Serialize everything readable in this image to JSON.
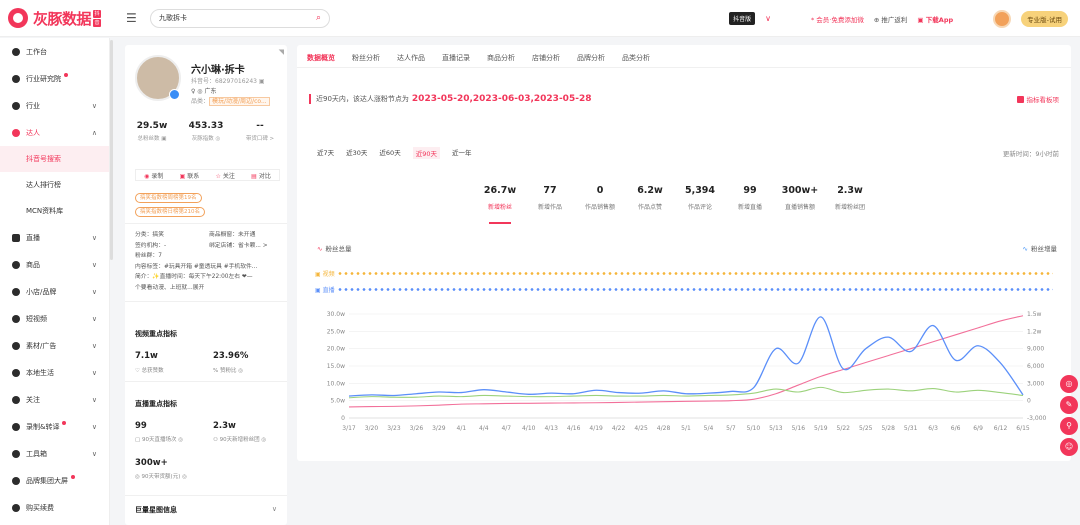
{
  "app": {
    "logo_text": "灰豚数据",
    "logo_badge": [
      "抖",
      "音"
    ]
  },
  "search": {
    "value": "九歌拆卡"
  },
  "topbar": {
    "lang": "抖音版",
    "promo1": "* 会员·免费添加微",
    "promo2": "⊕ 推广返利",
    "app_link": "▣ 下载App",
    "pro_btn": "专业版-试用"
  },
  "sidebar": [
    {
      "label": "工作台",
      "icon": "circle",
      "chevron": false,
      "dot": false
    },
    {
      "label": "行业研究院",
      "icon": "circle",
      "chevron": false,
      "dot": true
    },
    {
      "label": "行业",
      "icon": "circle",
      "chevron": true,
      "dot": false
    },
    {
      "label": "达人",
      "icon": "circle",
      "chevron": true,
      "dot": false,
      "active": true,
      "children": [
        {
          "label": "抖音号搜索",
          "active": true
        },
        {
          "label": "达人排行榜"
        },
        {
          "label": "MCN资料库"
        }
      ]
    },
    {
      "label": "直播",
      "icon": "square",
      "chevron": true,
      "dot": false
    },
    {
      "label": "商品",
      "icon": "circle",
      "chevron": true,
      "dot": false
    },
    {
      "label": "小店/品牌",
      "icon": "circle",
      "chevron": true,
      "dot": false
    },
    {
      "label": "短视频",
      "icon": "circle",
      "chevron": true,
      "dot": false
    },
    {
      "label": "素材/广告",
      "icon": "circle",
      "chevron": true,
      "dot": false
    },
    {
      "label": "本地生活",
      "icon": "circle",
      "chevron": true,
      "dot": false
    },
    {
      "label": "关注",
      "icon": "circle",
      "chevron": true,
      "dot": false
    },
    {
      "label": "录制&转译",
      "icon": "circle",
      "chevron": true,
      "dot": true
    },
    {
      "label": "工具箱",
      "icon": "circle",
      "chevron": true,
      "dot": false
    },
    {
      "label": "品牌集团大屏",
      "icon": "circle",
      "chevron": false,
      "dot": true
    },
    {
      "label": "购买续费",
      "icon": "circle",
      "chevron": false,
      "dot": false
    }
  ],
  "profile": {
    "name": "六小琳·拆卡",
    "id": "抖音号：68297016243 ▣",
    "location": "♀ ◎ 广东",
    "category_label": "品类：",
    "category_value": "模玩/动漫/周边/co...",
    "stats": [
      {
        "value": "29.5w",
        "label": "总粉丝数 ▣"
      },
      {
        "value": "453.33",
        "label": "灰豚指数 ◎"
      },
      {
        "value": "--",
        "label": "带货口碑 >"
      }
    ],
    "actions": [
      {
        "icon": "◉",
        "label": "录制"
      },
      {
        "icon": "▣",
        "label": "联系"
      },
      {
        "icon": "☆",
        "label": "关注"
      },
      {
        "icon": "▤",
        "label": "对比"
      }
    ],
    "rank_tags": [
      "搞笑指数榜周榜第19名",
      "搞笑指数榜日榜第210名"
    ],
    "info": [
      [
        "分类：搞笑",
        "商品橱窗：未开通"
      ],
      [
        "签约机构：-",
        "绑定店铺：省卡颗... >"
      ],
      [
        "粉丝群：7",
        ""
      ],
      [
        "内容标签：#玩具开箱 #童透玩具 #手机软件...",
        ""
      ],
      [
        "简介：✨直播时间：每天下午22:00左右 ❤—",
        ""
      ],
      [
        "个要看动漫、上班就...展开",
        ""
      ]
    ],
    "video_section": {
      "title": "视频重点指标",
      "kpis": [
        {
          "value": "7.1w",
          "label": "♡ 总获赞数"
        },
        {
          "value": "23.96%",
          "label": "% 赞粉比 ◎"
        }
      ]
    },
    "live_section": {
      "title": "直播重点指标",
      "kpis": [
        {
          "value": "99",
          "label": "▢ 90天直播场次 ◎"
        },
        {
          "value": "2.3w",
          "label": "⚇ 90天新增粉丝团 ◎"
        },
        {
          "value": "300w+",
          "label": "◎ 90天带货额(元) ◎"
        }
      ]
    },
    "bottom_title": "巨量星图信息",
    "bottom_chev": "∨"
  },
  "main": {
    "tabs": [
      "数据概览",
      "粉丝分析",
      "达人作品",
      "直播记录",
      "商品分析",
      "店铺分析",
      "品牌分析",
      "品类分析"
    ],
    "period_note": "近90天内，该达人涨粉节点为",
    "period_dates": "2023-05-20,2023-06-03,2023-05-28",
    "metric_btn": "指标看板项",
    "ranges": [
      "近7天",
      "近30天",
      "近60天",
      "近90天",
      "近一年"
    ],
    "range_active": 3,
    "updated": "更新时间：9小时前",
    "metrics": [
      {
        "value": "26.7w",
        "label": "新增粉丝"
      },
      {
        "value": "77",
        "label": "新增作品"
      },
      {
        "value": "0",
        "label": "作品销售额"
      },
      {
        "value": "6.2w",
        "label": "作品点赞"
      },
      {
        "value": "5,394",
        "label": "作品评论"
      },
      {
        "value": "99",
        "label": "新增直播"
      },
      {
        "value": "300w+",
        "label": "直播销售额"
      },
      {
        "value": "2.3w",
        "label": "新增粉丝团"
      }
    ],
    "legend_left": "粉丝总量",
    "legend_right": "粉丝增量",
    "event_rows": [
      {
        "label": "▣ 视频",
        "color": "#f5b63b"
      },
      {
        "label": "▣ 直播",
        "color": "#5b8ff9"
      }
    ]
  },
  "chart_data": {
    "type": "line",
    "x": [
      "3/17",
      "3/20",
      "3/23",
      "3/26",
      "3/29",
      "4/1",
      "4/4",
      "4/7",
      "4/10",
      "4/13",
      "4/16",
      "4/19",
      "4/22",
      "4/25",
      "4/28",
      "5/1",
      "5/4",
      "5/7",
      "5/10",
      "5/13",
      "5/16",
      "5/19",
      "5/22",
      "5/25",
      "5/28",
      "5/31",
      "6/3",
      "6/6",
      "6/9",
      "6/12",
      "6/15"
    ],
    "left_axis": {
      "ticks": [
        "0",
        "5.0w",
        "10.0w",
        "15.0w",
        "20.0w",
        "25.0w",
        "30.0w"
      ],
      "min": 0,
      "max": 300000
    },
    "right_axis": {
      "ticks": [
        "-3,000",
        "0",
        "3,000",
        "6,000",
        "9,000",
        "1.2w",
        "1.5w"
      ],
      "min": -3000,
      "max": 15000
    },
    "series": [
      {
        "name": "粉丝总量",
        "axis": "left",
        "color": "#f2709a",
        "values": [
          32000,
          33000,
          33500,
          35000,
          37000,
          40000,
          41000,
          42000,
          42500,
          43000,
          43500,
          44000,
          45000,
          46000,
          47000,
          48000,
          49000,
          50000,
          54000,
          70000,
          95000,
          120000,
          140000,
          160000,
          180000,
          200000,
          220000,
          240000,
          260000,
          280000,
          295000
        ]
      },
      {
        "name": "粉丝增量",
        "axis": "right",
        "color": "#5b8ff9",
        "values": [
          800,
          1000,
          900,
          1200,
          1500,
          1400,
          1900,
          1500,
          1100,
          1300,
          1200,
          1800,
          1400,
          1300,
          1700,
          1200,
          1300,
          1600,
          2200,
          9000,
          6500,
          14500,
          5500,
          9000,
          11000,
          8500,
          13000,
          7000,
          9500,
          6500,
          1000
        ]
      },
      {
        "name": "",
        "axis": "right",
        "color": "#9cd27c",
        "values": [
          500,
          700,
          600,
          600,
          800,
          700,
          900,
          800,
          700,
          700,
          800,
          900,
          800,
          800,
          900,
          800,
          900,
          1000,
          1300,
          2000,
          1500,
          2300,
          1400,
          1800,
          2000,
          1700,
          2100,
          1500,
          1800,
          1400,
          900
        ]
      }
    ]
  }
}
